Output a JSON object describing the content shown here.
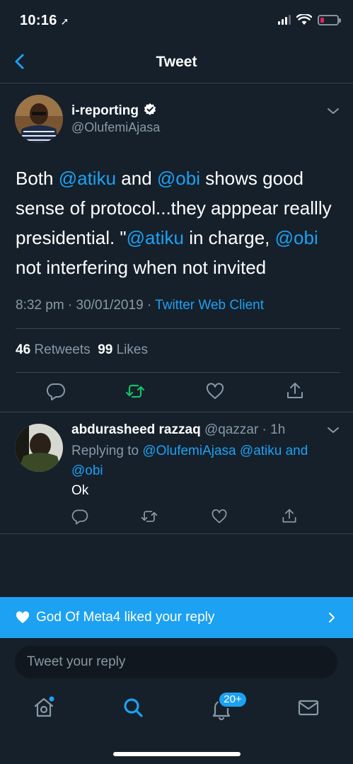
{
  "status_bar": {
    "time": "10:16",
    "location_arrow": "➚"
  },
  "header": {
    "title": "Tweet"
  },
  "tweet": {
    "author_name": "i-reporting",
    "author_handle": "@OlufemiAjasa",
    "text_parts": {
      "p1": "Both ",
      "m1": "@atiku",
      "p2": " and ",
      "m2": "@obi",
      "p3": " shows good sense of protocol...they apppear reallly presidential. \"",
      "m3": "@atiku",
      "p4": " in charge, ",
      "m4": "@obi",
      "p5": " not interfering when not invited"
    },
    "timestamp": "8:32 pm · 30/01/2019 · ",
    "client": "Twitter Web Client",
    "retweets_count": "46",
    "retweets_label": "Retweets",
    "likes_count": "99",
    "likes_label": "Likes"
  },
  "reply": {
    "name": "abdurasheed razzaq",
    "handle": "@qazzar",
    "time": " · 1h",
    "replying_prefix": "Replying to ",
    "replying_to_1": "@OlufemiAjasa",
    "replying_to_2": "@atiku",
    "replying_and": "and",
    "replying_to_3": "@obi",
    "text": "Ok"
  },
  "toast": {
    "text": "God Of Meta4 liked your reply"
  },
  "compose": {
    "placeholder": "Tweet your reply"
  },
  "tabbar": {
    "notifications_badge": "20+"
  },
  "colors": {
    "background": "#15202b",
    "accent": "#1da1f2",
    "retweet_active": "#17bf63",
    "divider": "#38444d",
    "muted": "#8899a6"
  }
}
